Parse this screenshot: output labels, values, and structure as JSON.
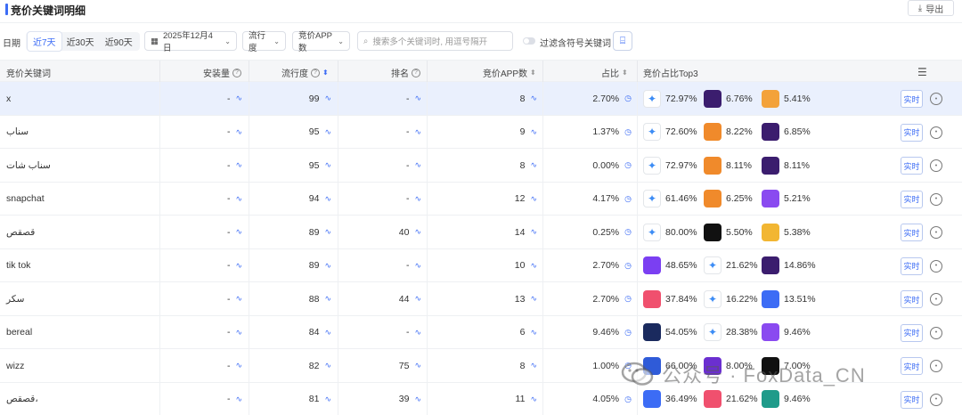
{
  "header": {
    "title": "竞价关键词明细",
    "export_label": "导出"
  },
  "filters": {
    "date_label": "日期",
    "ranges": [
      "近7天",
      "近30天",
      "近90天"
    ],
    "active_range": "近7天",
    "date_value": "2025年12月4日",
    "popularity_select": "流行度",
    "app_count_select": "竞价APP数",
    "search_placeholder": "搜索多个关键词时, 用逗号隔开",
    "exclude_symbols_label": "过滤含符号关键词"
  },
  "table": {
    "columns": [
      "竞价关键词",
      "安装量",
      "流行度",
      "排名",
      "竞价APP数",
      "占比",
      "竞价占比Top3"
    ],
    "rows": [
      {
        "keyword": "x",
        "installs": "-",
        "popularity": "99",
        "rank": "-",
        "app_count": "8",
        "share": "2.70%",
        "top3": [
          {
            "icon": "app-store-icon",
            "color": "#ffffff",
            "pct": "72.97%"
          },
          {
            "icon": "purple-app-icon",
            "color": "#3b1d6e",
            "pct": "6.76%"
          },
          {
            "icon": "orange-app-icon",
            "color": "#f3a23a",
            "pct": "5.41%"
          }
        ]
      },
      {
        "keyword": "سناب",
        "installs": "-",
        "popularity": "95",
        "rank": "-",
        "app_count": "9",
        "share": "1.37%",
        "top3": [
          {
            "icon": "app-store-icon",
            "color": "#ffffff",
            "pct": "72.60%"
          },
          {
            "icon": "orange-app-icon",
            "color": "#f08a2b",
            "pct": "8.22%"
          },
          {
            "icon": "purple-app-icon",
            "color": "#3b1d6e",
            "pct": "6.85%"
          }
        ]
      },
      {
        "keyword": "سناب شات",
        "installs": "-",
        "popularity": "95",
        "rank": "-",
        "app_count": "8",
        "share": "0.00%",
        "top3": [
          {
            "icon": "app-store-icon",
            "color": "#ffffff",
            "pct": "72.97%"
          },
          {
            "icon": "orange-app-icon",
            "color": "#f08a2b",
            "pct": "8.11%"
          },
          {
            "icon": "purple-app-icon",
            "color": "#3b1d6e",
            "pct": "8.11%"
          }
        ]
      },
      {
        "keyword": "snapchat",
        "installs": "-",
        "popularity": "94",
        "rank": "-",
        "app_count": "12",
        "share": "4.17%",
        "top3": [
          {
            "icon": "app-store-icon",
            "color": "#ffffff",
            "pct": "61.46%"
          },
          {
            "icon": "orange-app-icon",
            "color": "#f08a2b",
            "pct": "6.25%"
          },
          {
            "icon": "violet-app-icon",
            "color": "#8a4af0",
            "pct": "5.21%"
          }
        ]
      },
      {
        "keyword": "قصقص",
        "installs": "-",
        "popularity": "89",
        "rank": "40",
        "app_count": "14",
        "share": "0.25%",
        "top3": [
          {
            "icon": "app-store-icon",
            "color": "#ffffff",
            "pct": "80.00%"
          },
          {
            "icon": "black-app-icon",
            "color": "#111111",
            "pct": "5.50%"
          },
          {
            "icon": "yellow-app-icon",
            "color": "#f2b632",
            "pct": "5.38%"
          }
        ]
      },
      {
        "keyword": "tik tok",
        "installs": "-",
        "popularity": "89",
        "rank": "-",
        "app_count": "10",
        "share": "2.70%",
        "top3": [
          {
            "icon": "violet-app-icon",
            "color": "#7b3ff2",
            "pct": "48.65%"
          },
          {
            "icon": "app-store-icon",
            "color": "#ffffff",
            "pct": "21.62%"
          },
          {
            "icon": "purple-app-icon",
            "color": "#3b1d6e",
            "pct": "14.86%"
          }
        ]
      },
      {
        "keyword": "سكر",
        "installs": "-",
        "popularity": "88",
        "rank": "44",
        "app_count": "13",
        "share": "2.70%",
        "top3": [
          {
            "icon": "red-app-icon",
            "color": "#f0506e",
            "pct": "37.84%"
          },
          {
            "icon": "app-store-icon",
            "color": "#ffffff",
            "pct": "16.22%"
          },
          {
            "icon": "blue-app-icon",
            "color": "#3c6cf5",
            "pct": "13.51%"
          }
        ]
      },
      {
        "keyword": "bereal",
        "installs": "-",
        "popularity": "84",
        "rank": "-",
        "app_count": "6",
        "share": "9.46%",
        "top3": [
          {
            "icon": "navy-app-icon",
            "color": "#1a2a5e",
            "pct": "54.05%"
          },
          {
            "icon": "app-store-icon",
            "color": "#ffffff",
            "pct": "28.38%"
          },
          {
            "icon": "violet-app-icon",
            "color": "#8a4af0",
            "pct": "9.46%"
          }
        ]
      },
      {
        "keyword": "wizz",
        "installs": "-",
        "popularity": "82",
        "rank": "75",
        "app_count": "8",
        "share": "1.00%",
        "top3": [
          {
            "icon": "blue-app-icon",
            "color": "#2f5bd8",
            "pct": "66.00%"
          },
          {
            "icon": "purple-app-icon",
            "color": "#6b2fd0",
            "pct": "8.00%"
          },
          {
            "icon": "black-app-icon",
            "color": "#111111",
            "pct": "7.00%"
          }
        ]
      },
      {
        "keyword": "قصقص،",
        "installs": "-",
        "popularity": "81",
        "rank": "39",
        "app_count": "11",
        "share": "4.05%",
        "top3": [
          {
            "icon": "blue-app-icon",
            "color": "#3c6cf5",
            "pct": "36.49%"
          },
          {
            "icon": "red-app-icon",
            "color": "#f0506e",
            "pct": "21.62%"
          },
          {
            "icon": "teal-app-icon",
            "color": "#1f9b8a",
            "pct": "9.46%"
          }
        ]
      }
    ],
    "realtime_label": "实时"
  },
  "watermark": "公众号 · FoxData_CN"
}
